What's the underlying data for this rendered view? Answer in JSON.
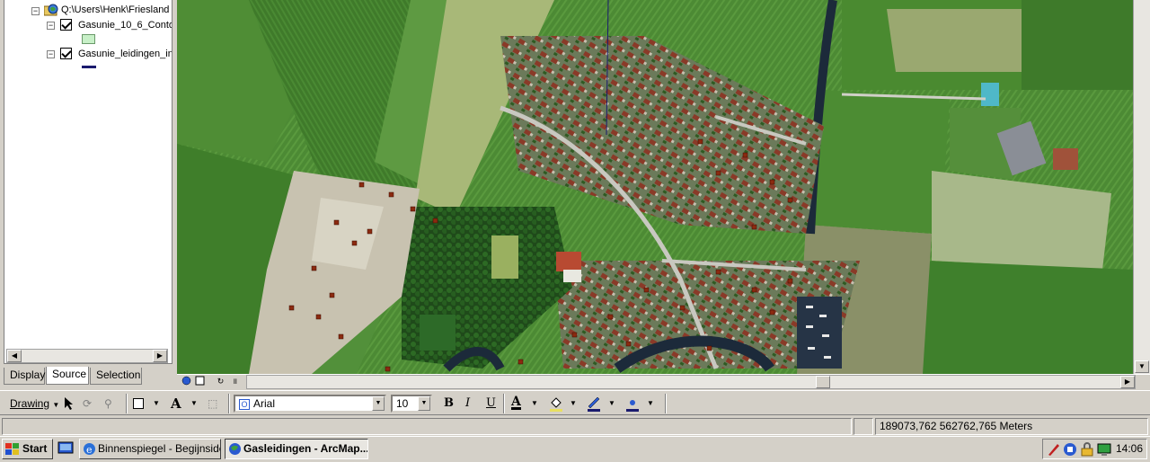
{
  "toc": {
    "root_label": "Q:\\Users\\Henk\\Friesland",
    "layers": [
      {
        "label": "Gasunie_10_6_Conto",
        "checked": true
      },
      {
        "label": "Gasunie_leidingen_in",
        "checked": true
      }
    ],
    "tabs": [
      "Display",
      "Source",
      "Selection"
    ],
    "active_tab": "Source"
  },
  "drawing_toolbar": {
    "drawing_label": "Drawing",
    "font_name": "Arial",
    "font_size": "10",
    "bold": "B",
    "italic": "I",
    "underline": "U",
    "font_color_letter": "A",
    "text_tool_letter": "A"
  },
  "status": {
    "coordinates": "189073,762  562762,765 Meters"
  },
  "taskbar": {
    "start_label": "Start",
    "tasks": [
      "Binnenspiegel - Begijnside...",
      "Gasleidingen - ArcMap..."
    ],
    "active_task": "Gasleidingen - ArcMap...",
    "clock": "14:06"
  },
  "colors": {
    "legend_fill": "#c8f0c8",
    "pipeline_line": "#1a1a6e",
    "marker": "#8b2a10"
  }
}
